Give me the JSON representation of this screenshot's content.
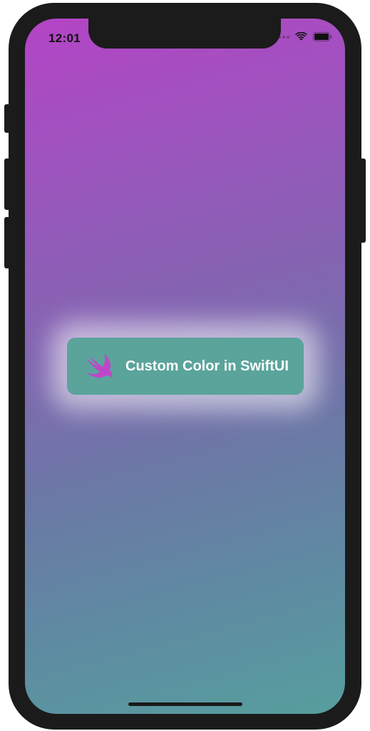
{
  "status_bar": {
    "time": "12:01"
  },
  "icons": {
    "wifi": "wifi-icon",
    "battery": "battery-icon",
    "swift": "swift-logo-icon"
  },
  "main": {
    "button_label": "Custom Color in SwiftUI"
  },
  "colors": {
    "gradient_top": "#b444c6",
    "gradient_bottom": "#579e9e",
    "button_background": "#5aa49b",
    "swift_logo": "#c046c9"
  }
}
